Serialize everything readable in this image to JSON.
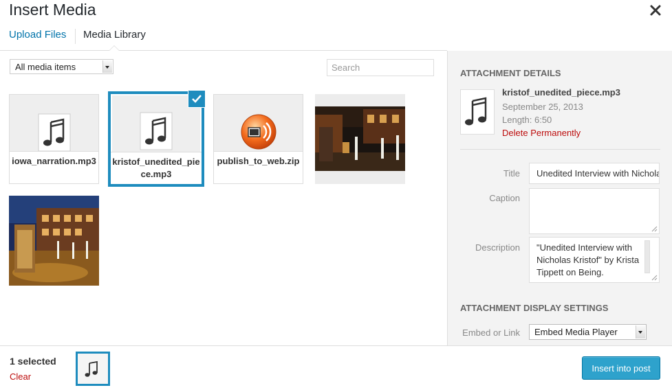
{
  "header": {
    "title": "Insert Media",
    "close_icon": "close-icon",
    "tabs": [
      {
        "label": "Upload Files",
        "active": false
      },
      {
        "label": "Media Library",
        "active": true
      }
    ]
  },
  "toolbar": {
    "filter_value": "All media items",
    "search_placeholder": "Search"
  },
  "attachments": [
    {
      "filename": "iowa_narration.mp3",
      "type": "audio",
      "selected": false
    },
    {
      "filename": "kristof_unedited_piece.mp3",
      "type": "audio",
      "selected": true
    },
    {
      "filename": "publish_to_web.zip",
      "type": "archive",
      "selected": false
    },
    {
      "type": "image",
      "selected": false
    },
    {
      "type": "image",
      "selected": false
    }
  ],
  "details": {
    "heading": "Attachment Details",
    "filename": "kristof_unedited_piece.mp3",
    "date": "September 25, 2013",
    "length": "Length: 6:50",
    "delete_label": "Delete Permanently",
    "fields": {
      "title_label": "Title",
      "title_value": "Unedited Interview with Nicholas Kristof",
      "caption_label": "Caption",
      "caption_value": "",
      "description_label": "Description",
      "description_value": "\"Unedited Interview with Nicholas Kristof\" by Krista Tippett on Being."
    }
  },
  "display_settings": {
    "heading": "Attachment Display Settings",
    "embed_label": "Embed or Link",
    "embed_value": "Embed Media Player"
  },
  "footer": {
    "selected_count": "1 selected",
    "clear_label": "Clear",
    "insert_label": "Insert into post"
  },
  "colors": {
    "accent": "#1e8cbe",
    "link": "#0073aa",
    "danger": "#bc0b0b",
    "primary_button": "#2ea2cc"
  }
}
